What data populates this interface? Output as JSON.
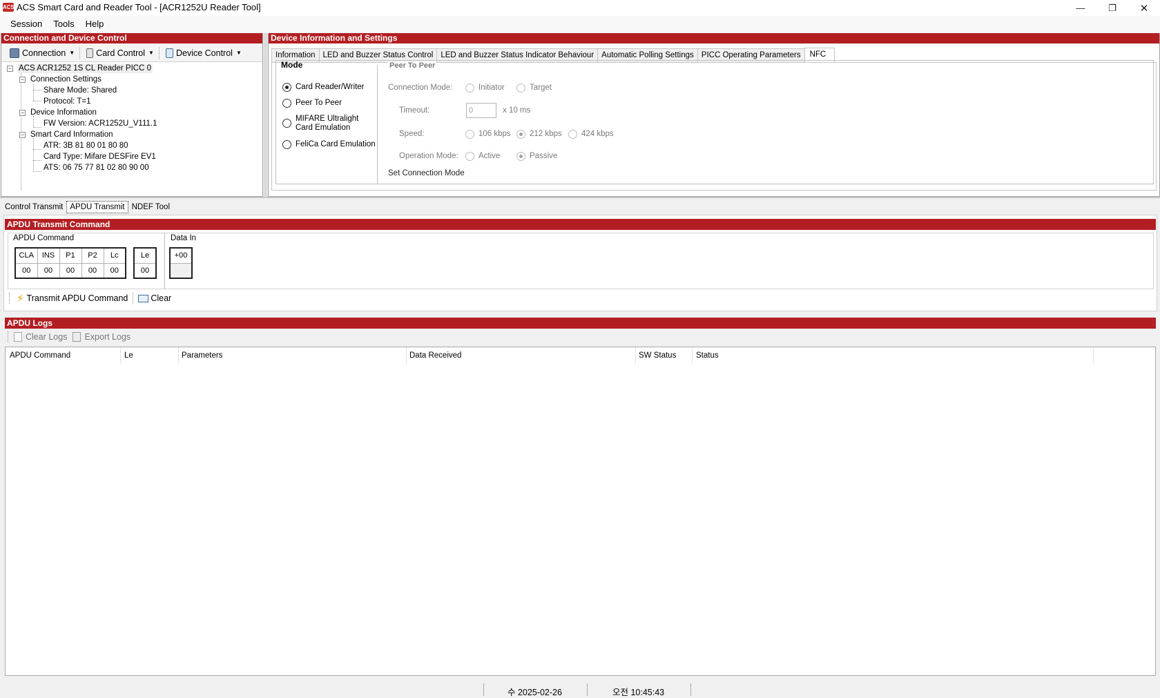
{
  "window": {
    "title": "ACS Smart Card and Reader Tool - [ACR1252U Reader Tool]",
    "icon_label": "ACS",
    "controls": {
      "minimize": "—",
      "restore": "❐",
      "close": "✕"
    }
  },
  "menu": [
    "Session",
    "Tools",
    "Help"
  ],
  "left_panel": {
    "header": "Connection and Device Control",
    "toolbar": {
      "connection": "Connection",
      "card_control": "Card Control",
      "device_control": "Device Control"
    },
    "tree": {
      "root": "ACS ACR1252 1S CL Reader PICC 0",
      "connection_settings": "Connection Settings",
      "share_mode": "Share Mode: Shared",
      "protocol": "Protocol: T=1",
      "device_information": "Device Information",
      "fw_version": "FW Version: ACR1252U_V111.1",
      "smart_card_information": "Smart Card Information",
      "atr": "ATR: 3B 81 80 01 80 80",
      "card_type": "Card Type: Mifare DESFire EV1",
      "ats": "ATS: 06 75 77 81 02 80 90 00"
    }
  },
  "right_panel": {
    "header": "Device Information and Settings",
    "tabs": [
      "Information",
      "LED and Buzzer Status Control",
      "LED and Buzzer Status Indicator Behaviour",
      "Automatic Polling Settings",
      "PICC Operating Parameters",
      "NFC"
    ],
    "nfc": {
      "mode_title": "Mode",
      "modes": [
        "Card Reader/Writer",
        "Peer To Peer",
        "MIFARE Ultralight Card Emulation",
        "FeliCa Card Emulation"
      ],
      "selected_mode": "Card Reader/Writer",
      "p2p_title": "Peer To Peer",
      "connection_mode_label": "Connection Mode:",
      "connection_modes": [
        "Initiator",
        "Target"
      ],
      "timeout_label": "Timeout:",
      "timeout_value": "0",
      "timeout_unit": "x 10 ms",
      "speed_label": "Speed:",
      "speeds": [
        "106 kbps",
        "212 kbps",
        "424 kbps"
      ],
      "selected_speed": "212 kbps",
      "operation_mode_label": "Operation Mode:",
      "operation_modes": [
        "Active",
        "Passive"
      ],
      "selected_operation_mode": "Passive",
      "set_button": "Set Connection Mode"
    }
  },
  "bottom_tabs": [
    "Control Transmit",
    "APDU Transmit",
    "NDEF Tool"
  ],
  "apdu": {
    "header": "APDU Transmit Command",
    "command_group": "APDU Command",
    "fields": {
      "cla": "CLA",
      "ins": "INS",
      "p1": "P1",
      "p2": "P2",
      "lc": "Lc",
      "le": "Le"
    },
    "values": {
      "cla": "00",
      "ins": "00",
      "p1": "00",
      "p2": "00",
      "lc": "00",
      "le": "00"
    },
    "data_in_group": "Data In",
    "data_in_header": "+00",
    "transmit_button": "Transmit APDU Command",
    "clear_button": "Clear"
  },
  "logs": {
    "header": "APDU Logs",
    "clear_logs": "Clear Logs",
    "export_logs": "Export Logs",
    "columns": [
      "APDU Command",
      "Le",
      "Parameters",
      "Data Received",
      "SW Status",
      "Status"
    ]
  },
  "status_bar": {
    "date": "수 2025-02-26",
    "time": "오전 10:45:43"
  },
  "colors": {
    "section_header": "#b31e22",
    "window_bg": "#f0f0f0"
  },
  "icons": [
    "connection-icon",
    "card-icon",
    "device-icon",
    "lightning-icon",
    "clear-icon",
    "clear-logs-icon",
    "export-icon"
  ]
}
